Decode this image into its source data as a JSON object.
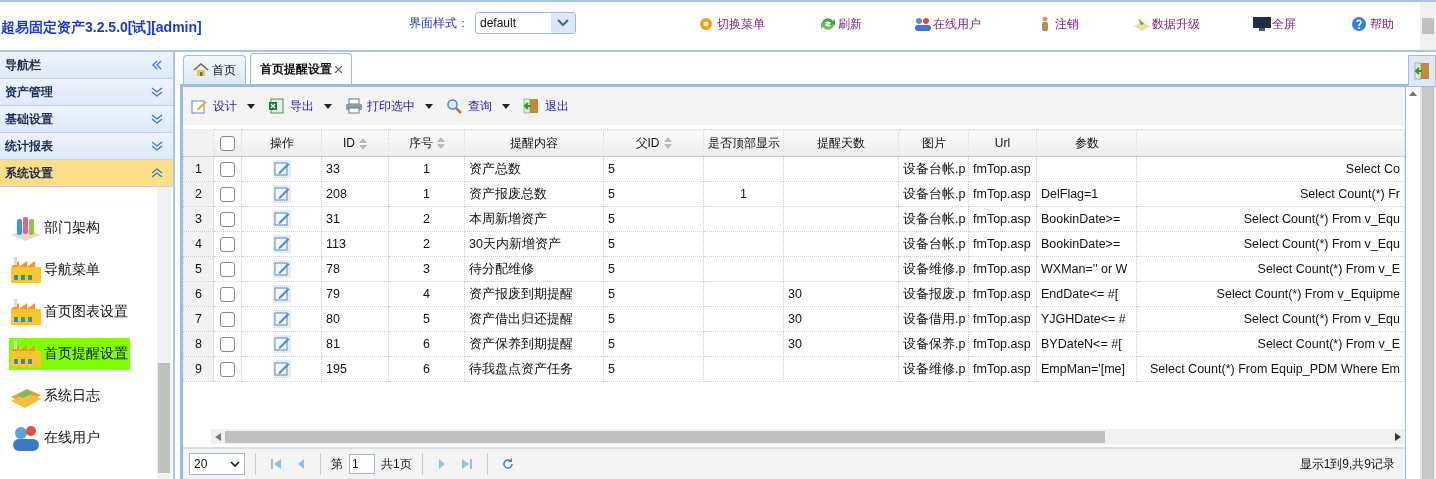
{
  "header": {
    "title": "超易固定资产3.2.5.0[试][admin]",
    "style_label": "界面样式：",
    "style_value": "default",
    "links": [
      {
        "label": "切换菜单"
      },
      {
        "label": "刷新"
      },
      {
        "label": "在线用户"
      },
      {
        "label": "注销"
      },
      {
        "label": "数据升级"
      },
      {
        "label": "全屏"
      },
      {
        "label": "帮助"
      }
    ]
  },
  "sidebar": {
    "title": "导航栏",
    "sections": [
      {
        "label": "资产管理",
        "expanded": false
      },
      {
        "label": "基础设置",
        "expanded": false
      },
      {
        "label": "统计报表",
        "expanded": false
      },
      {
        "label": "系统设置",
        "expanded": true
      }
    ],
    "items": [
      {
        "label": "部门架构",
        "selected": false
      },
      {
        "label": "导航菜单",
        "selected": false
      },
      {
        "label": "首页图表设置",
        "selected": false
      },
      {
        "label": "首页提醒设置",
        "selected": true
      },
      {
        "label": "系统日志",
        "selected": false
      },
      {
        "label": "在线用户",
        "selected": false
      }
    ]
  },
  "tabs": [
    {
      "label": "首页",
      "selected": false,
      "closable": false
    },
    {
      "label": "首页提醒设置",
      "selected": true,
      "closable": true
    }
  ],
  "toolbar": [
    {
      "label": "设计",
      "dropdown": true
    },
    {
      "label": "导出",
      "dropdown": true
    },
    {
      "label": "打印选中",
      "dropdown": true
    },
    {
      "label": "查询",
      "dropdown": true
    },
    {
      "label": "退出",
      "dropdown": false
    }
  ],
  "table": {
    "select_all_checked": false,
    "columns": [
      {
        "label": "操作",
        "sortable": false
      },
      {
        "label": "ID",
        "sortable": true
      },
      {
        "label": "序号",
        "sortable": true
      },
      {
        "label": "提醒内容",
        "sortable": false
      },
      {
        "label": "父ID",
        "sortable": true
      },
      {
        "label": "是否顶部显示",
        "sortable": false
      },
      {
        "label": "提醒天数",
        "sortable": false
      },
      {
        "label": "图片",
        "sortable": false
      },
      {
        "label": "Url",
        "sortable": false
      },
      {
        "label": "参数",
        "sortable": false
      }
    ],
    "rows": [
      {
        "number": "1",
        "checked": false,
        "id": "33",
        "order": "1",
        "content": "资产总数",
        "parent_id": "5",
        "image": "设备台帐.p",
        "url": "fmTop.asp",
        "sql": "Select Co"
      },
      {
        "number": "2",
        "checked": false,
        "id": "208",
        "order": "1",
        "content": "资产报废总数",
        "parent_id": "5",
        "top_display": "1",
        "image": "设备台帐.p",
        "url": "fmTop.asp",
        "params": "DelFlag=1",
        "sql": "Select Count(*) Fr"
      },
      {
        "number": "3",
        "checked": false,
        "id": "31",
        "order": "2",
        "content": "本周新增资产",
        "parent_id": "5",
        "image": "设备台帐.p",
        "url": "fmTop.asp",
        "params": "BookinDate>=",
        "sql": "Select Count(*) From v_Equ"
      },
      {
        "number": "4",
        "checked": false,
        "id": "113",
        "order": "2",
        "content": "30天内新增资产",
        "parent_id": "5",
        "image": "设备台帐.p",
        "url": "fmTop.asp",
        "params": "BookinDate>=",
        "sql": "Select Count(*) From v_Equ"
      },
      {
        "number": "5",
        "checked": false,
        "id": "78",
        "order": "3",
        "content": "待分配维修",
        "parent_id": "5",
        "image": "设备维修.p",
        "url": "fmTop.asp",
        "params": "WXMan='' or W",
        "sql": "Select Count(*) From v_E"
      },
      {
        "number": "6",
        "checked": false,
        "id": "79",
        "order": "4",
        "content": "资产报废到期提醒",
        "parent_id": "5",
        "remind_days": "30",
        "image": "设备报废.p",
        "url": "fmTop.asp",
        "params": "EndDate<= #[",
        "sql": "Select Count(*) From v_Equipme"
      },
      {
        "number": "7",
        "checked": false,
        "id": "80",
        "order": "5",
        "content": "资产借出归还提醒",
        "parent_id": "5",
        "remind_days": "30",
        "image": "设备借用.p",
        "url": "fmTop.asp",
        "params": "YJGHDate<= #",
        "sql": "Select Count(*) From v_Equ"
      },
      {
        "number": "8",
        "checked": false,
        "id": "81",
        "order": "6",
        "content": "资产保养到期提醒",
        "parent_id": "5",
        "remind_days": "30",
        "image": "设备保养.p",
        "url": "fmTop.asp",
        "params": "BYDateN<= #[",
        "sql": "Select Count(*) From v_E"
      },
      {
        "number": "9",
        "checked": false,
        "id": "195",
        "order": "6",
        "content": "待我盘点资产任务",
        "parent_id": "5",
        "image": "设备维修.p",
        "url": "fmTop.asp",
        "params": "EmpMan='[me]",
        "sql": "Select Count(*) From Equip_PDM Where Em"
      }
    ]
  },
  "pager": {
    "page_size": "20",
    "page_prefix": "第",
    "page": "1",
    "page_suffix": "共1页",
    "summary": "显示1到9,共9记录"
  }
}
